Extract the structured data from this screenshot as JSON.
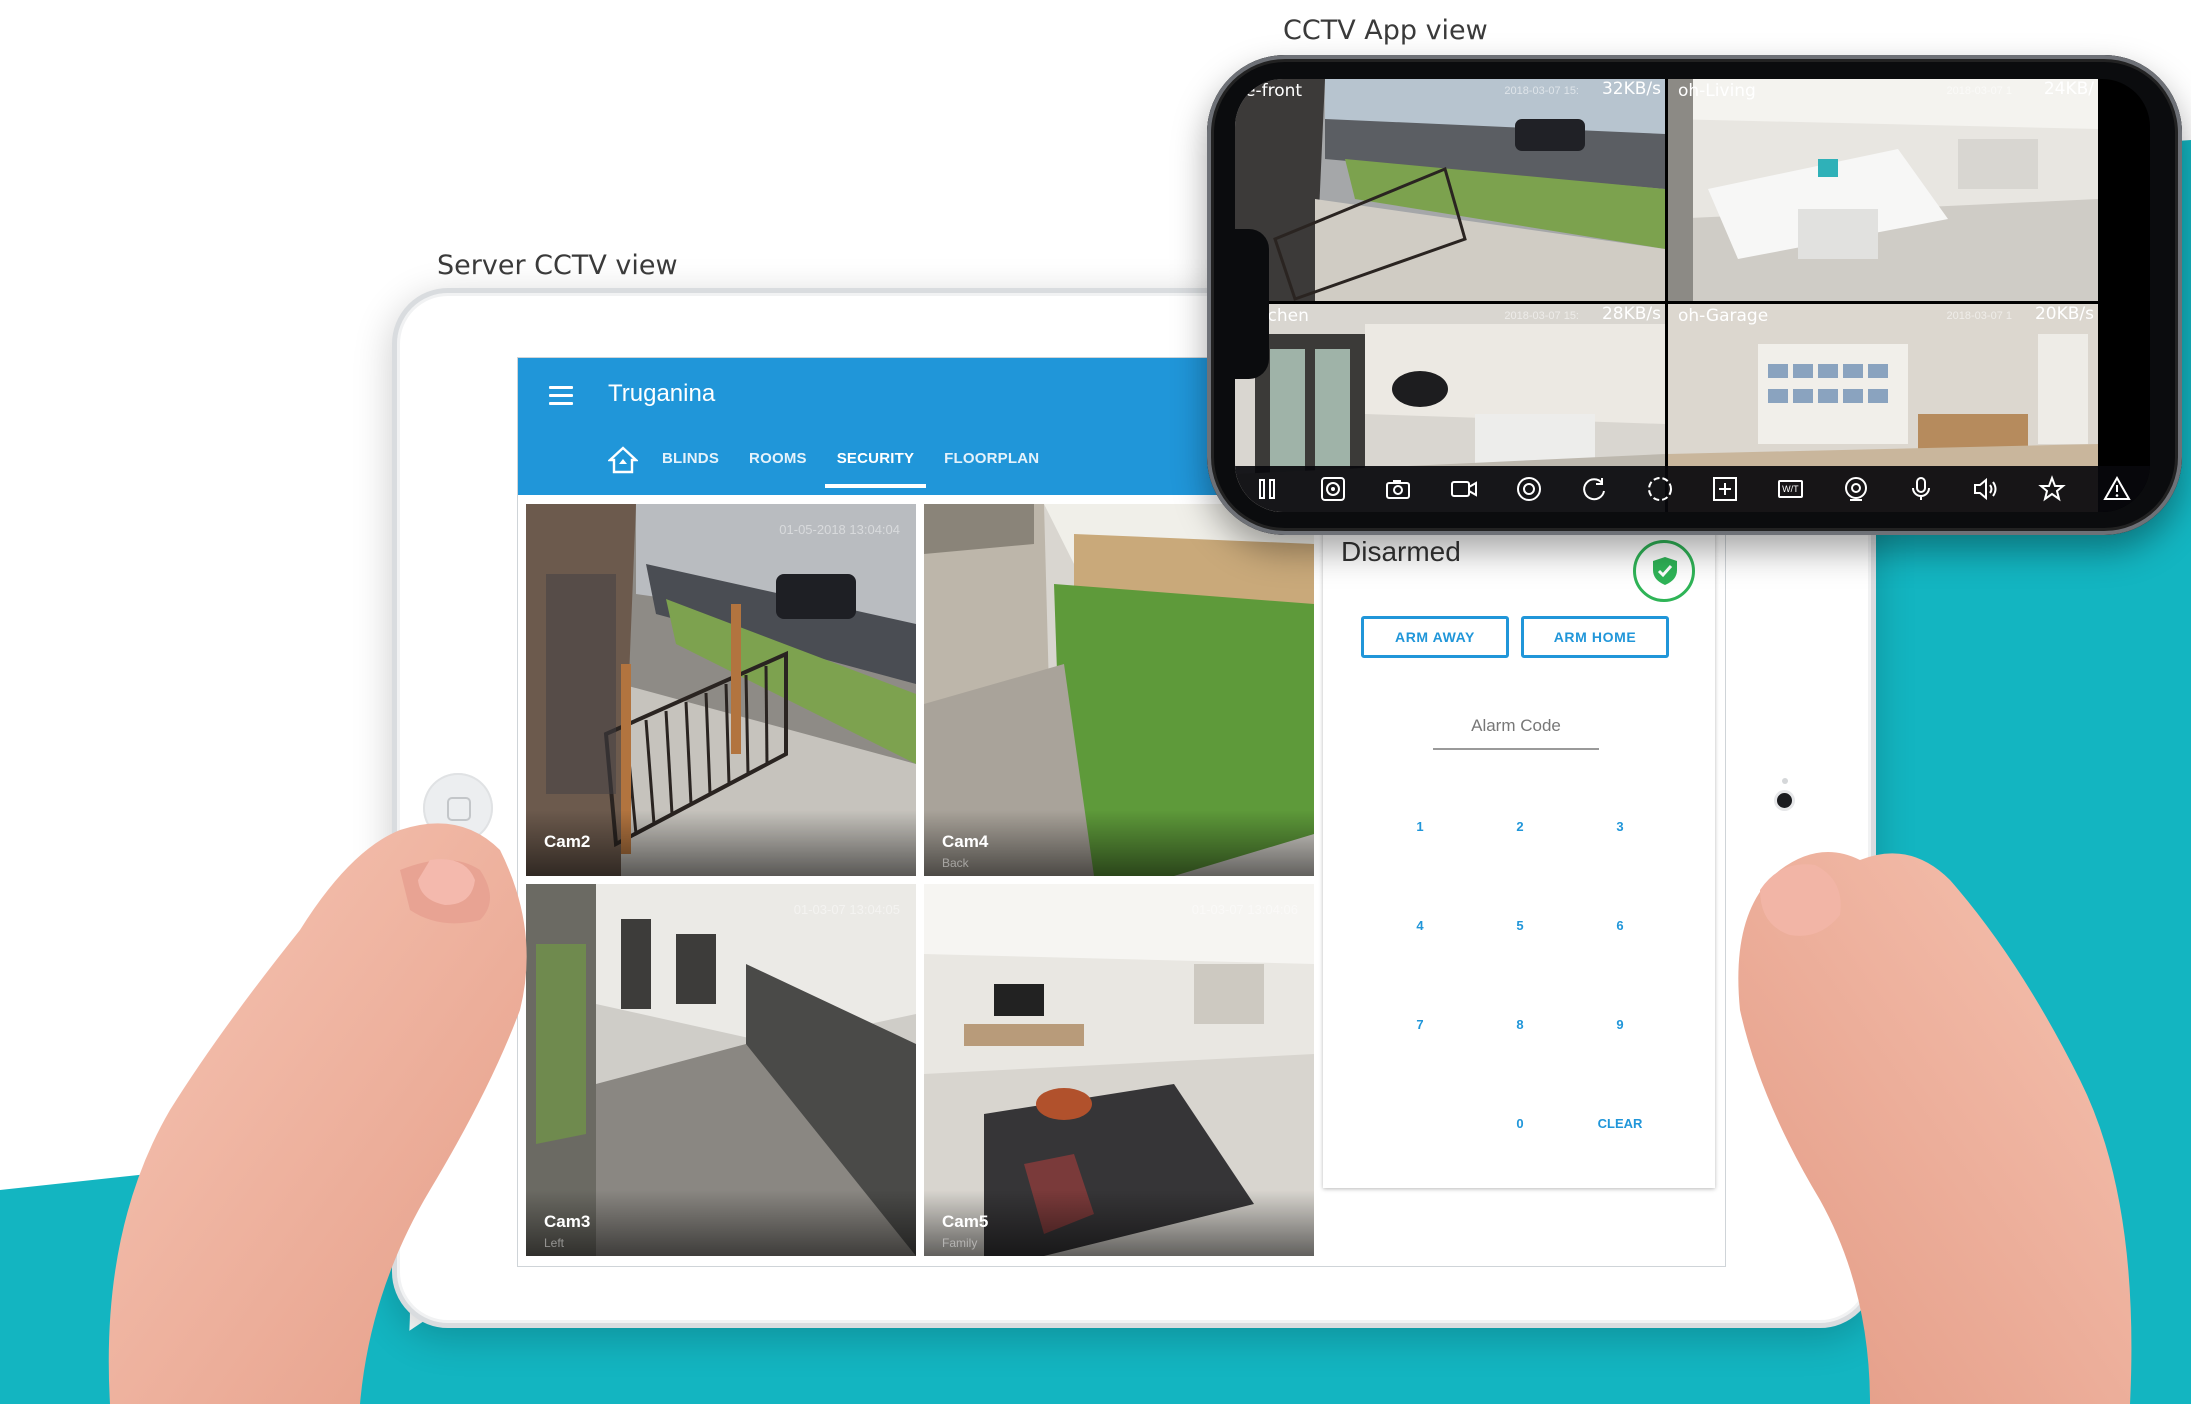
{
  "captions": {
    "server": "Server CCTV view",
    "app": "CCTV App view"
  },
  "tablet_app": {
    "title": "Truganina",
    "tabs": [
      "BLINDS",
      "ROOMS",
      "SECURITY",
      "FLOORPLAN"
    ],
    "active_tab": "SECURITY",
    "cameras": [
      {
        "name": "Cam2",
        "timestamp": "01-05-2018 13:04:04",
        "sub": ""
      },
      {
        "name": "Cam4",
        "timestamp": "",
        "sub": "Back"
      },
      {
        "name": "Cam3",
        "timestamp": "01-03-07 13:04:05",
        "sub": "Left"
      },
      {
        "name": "Cam5",
        "timestamp": "01-03-07 13:04:06",
        "sub": "Family"
      }
    ],
    "alarm": {
      "status": "Disarmed",
      "arm_away": "ARM AWAY",
      "arm_home": "ARM HOME",
      "code_placeholder": "Alarm Code",
      "keys": [
        "1",
        "2",
        "3",
        "4",
        "5",
        "6",
        "7",
        "8",
        "9",
        "0",
        "CLEAR"
      ]
    }
  },
  "phone_app": {
    "cameras": [
      {
        "label": "e-front",
        "date": "2018-03-07 15:",
        "rate": "32KB/s"
      },
      {
        "label": "oh-Living",
        "date": "2018-03-07 1",
        "rate": "24KB/"
      },
      {
        "label": "Kitchen",
        "date": "2018-03-07 15:",
        "rate": "28KB/s"
      },
      {
        "label": "oh-Garage",
        "date": "2018-03-07 1",
        "rate": "20KB/s"
      }
    ],
    "toolbar_icons": [
      "pause-icon",
      "ptz-icon",
      "snapshot-icon",
      "record-icon",
      "focus-icon",
      "rotate-icon",
      "fullscreen-icon",
      "zoom-icon",
      "wt-icon",
      "playback-icon",
      "mic-icon",
      "speaker-icon",
      "favorite-icon",
      "alert-icon"
    ],
    "wt_label": "W/T"
  },
  "colors": {
    "brand_blue": "#2096d9",
    "teal": "#13b5c1",
    "armed_green": "#2fb457"
  }
}
